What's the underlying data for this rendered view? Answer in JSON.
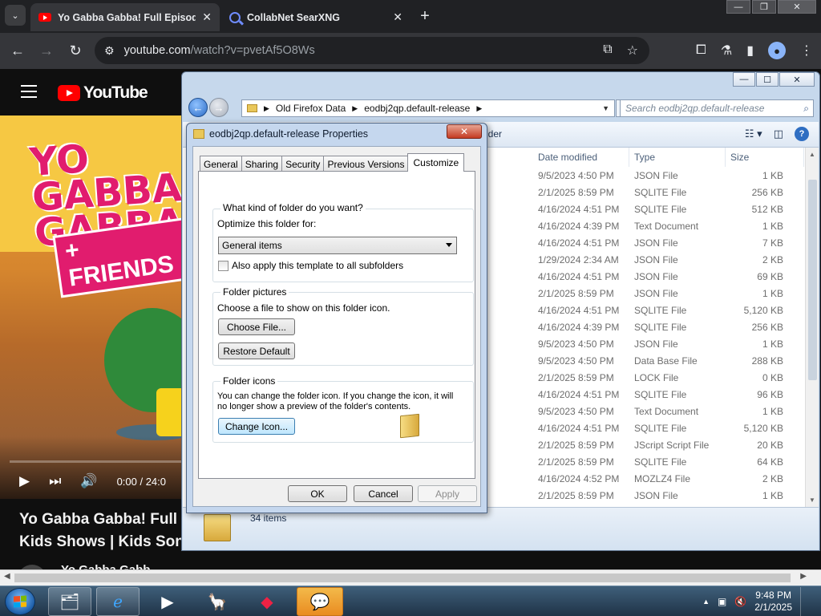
{
  "browser": {
    "tabs": [
      {
        "title": "Yo Gabba Gabba! Full Episodes",
        "active": true
      },
      {
        "title": "CollabNet SearXNG",
        "active": false
      }
    ],
    "url_host": "youtube.com",
    "url_path": "/watch?v=pvetAf5O8Ws",
    "window_controls": {
      "minimize": "—",
      "restore": "❐",
      "close": "✕"
    }
  },
  "youtube": {
    "logo_text": "YouTube",
    "video": {
      "logo_line1": "YO GABBA",
      "logo_line2": "GABBA",
      "banner": "+ FRIENDS",
      "time": "0:00 / 24:0",
      "progress": 0
    },
    "title_line1": "Yo Gabba Gabba! Full E",
    "title_line2": "Kids Shows | Kids Son",
    "channel": "Yo Gabba Gabb"
  },
  "explorer": {
    "breadcrumb": [
      "Old Firefox Data",
      "eodbj2qp.default-release"
    ],
    "search_placeholder": "Search eodbj2qp.default-release",
    "cmd_partial": "lder",
    "columns": {
      "date": "Date modified",
      "type": "Type",
      "size": "Size"
    },
    "rows": [
      {
        "date": "9/5/2023 4:50 PM",
        "type": "JSON File",
        "size": "1 KB"
      },
      {
        "date": "2/1/2025 8:59 PM",
        "type": "SQLITE File",
        "size": "256 KB"
      },
      {
        "date": "4/16/2024 4:51 PM",
        "type": "SQLITE File",
        "size": "512 KB"
      },
      {
        "date": "4/16/2024 4:39 PM",
        "type": "Text Document",
        "size": "1 KB"
      },
      {
        "date": "4/16/2024 4:51 PM",
        "type": "JSON File",
        "size": "7 KB"
      },
      {
        "date": "1/29/2024 2:34 AM",
        "type": "JSON File",
        "size": "2 KB"
      },
      {
        "date": "4/16/2024 4:51 PM",
        "type": "JSON File",
        "size": "69 KB"
      },
      {
        "date": "2/1/2025 8:59 PM",
        "type": "JSON File",
        "size": "1 KB"
      },
      {
        "date": "4/16/2024 4:51 PM",
        "type": "SQLITE File",
        "size": "5,120 KB"
      },
      {
        "date": "4/16/2024 4:39 PM",
        "type": "SQLITE File",
        "size": "256 KB"
      },
      {
        "date": "9/5/2023 4:50 PM",
        "type": "JSON File",
        "size": "1 KB"
      },
      {
        "date": "9/5/2023 4:50 PM",
        "type": "Data Base File",
        "size": "288 KB"
      },
      {
        "date": "2/1/2025 8:59 PM",
        "type": "LOCK File",
        "size": "0 KB"
      },
      {
        "date": "4/16/2024 4:51 PM",
        "type": "SQLITE File",
        "size": "96 KB"
      },
      {
        "date": "9/5/2023 4:50 PM",
        "type": "Text Document",
        "size": "1 KB"
      },
      {
        "date": "4/16/2024 4:51 PM",
        "type": "SQLITE File",
        "size": "5,120 KB"
      },
      {
        "date": "2/1/2025 8:59 PM",
        "type": "JScript Script File",
        "size": "20 KB"
      },
      {
        "date": "2/1/2025 8:59 PM",
        "type": "SQLITE File",
        "size": "64 KB"
      },
      {
        "date": "4/16/2024 4:52 PM",
        "type": "MOZLZ4 File",
        "size": "2 KB"
      },
      {
        "date": "2/1/2025 8:59 PM",
        "type": "JSON File",
        "size": "1 KB"
      }
    ],
    "item_count": "34 items"
  },
  "properties": {
    "title": "eodbj2qp.default-release Properties",
    "tabs": [
      "General",
      "Sharing",
      "Security",
      "Previous Versions",
      "Customize"
    ],
    "selected_tab": "Customize",
    "group1_label": "What kind of folder do you want?",
    "optimize_label": "Optimize this folder for:",
    "optimize_value": "General items",
    "apply_sub_label": "Also apply this template to all subfolders",
    "group2_label": "Folder pictures",
    "choose_file_text": "Choose a file to show on this folder icon.",
    "choose_file_btn": "Choose File...",
    "restore_btn": "Restore Default",
    "group3_label": "Folder icons",
    "icons_text_1": "You can change the folder icon. If you change the icon, it will",
    "icons_text_2": "no longer show a preview of the folder's contents.",
    "change_icon_btn": "Change Icon...",
    "ok": "OK",
    "cancel": "Cancel",
    "apply": "Apply",
    "close_glyph": "✕"
  },
  "taskbar": {
    "time": "9:48 PM",
    "date": "2/1/2025"
  }
}
